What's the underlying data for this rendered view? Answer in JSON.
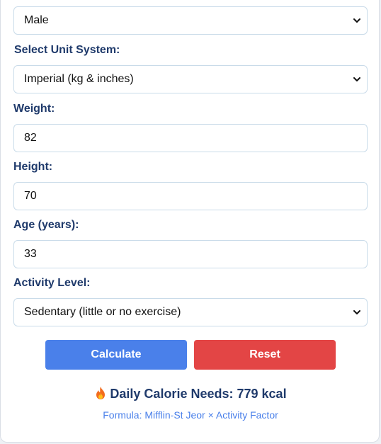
{
  "form": {
    "gender": {
      "selected": "Male"
    },
    "unit_system": {
      "label": "Select Unit System:",
      "selected": "Imperial (kg & inches)"
    },
    "weight": {
      "label": "Weight:",
      "value": "82"
    },
    "height": {
      "label": "Height:",
      "value": "70"
    },
    "age": {
      "label": "Age (years):",
      "value": "33"
    },
    "activity": {
      "label": "Activity Level:",
      "selected": "Sedentary (little or no exercise)"
    }
  },
  "buttons": {
    "calculate": "Calculate",
    "reset": "Reset"
  },
  "result": {
    "icon": "fire-icon",
    "label": "Daily Calorie Needs:",
    "value": "779 kcal"
  },
  "formula": "Formula: Mifflin-St Jeor × Activity Factor",
  "colors": {
    "label_text": "#1f3a6b",
    "calculate_button": "#4a80ea",
    "reset_button": "#e34545",
    "formula_text": "#4a80ea",
    "input_border": "#c9dbe9"
  }
}
